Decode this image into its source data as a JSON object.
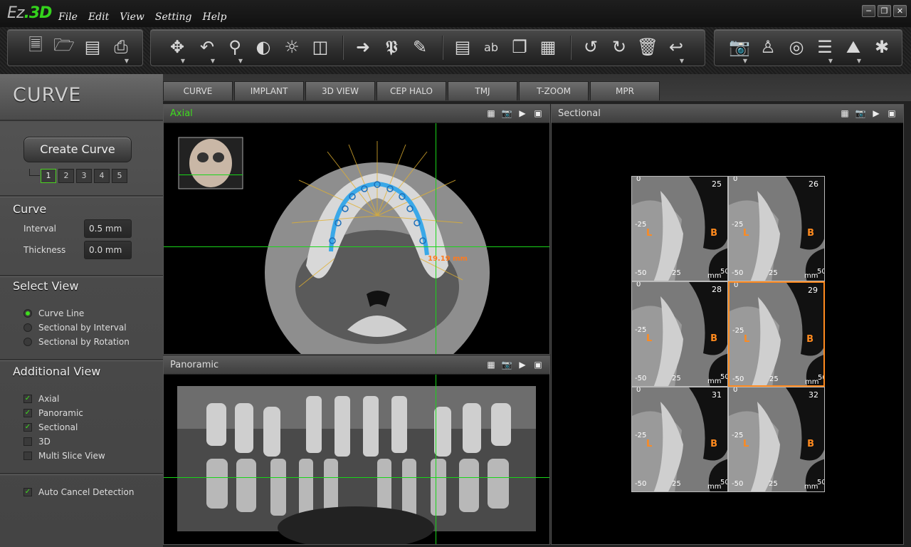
{
  "app": {
    "logo_prefix": "Ez",
    "logo_dot": ".",
    "logo_suffix": "3D"
  },
  "menu": [
    "File",
    "Edit",
    "View",
    "Setting",
    "Help"
  ],
  "window_controls": [
    "minimize",
    "restore",
    "close"
  ],
  "toolbar": {
    "group1": [
      "open-patient-icon",
      "import-icon",
      "save-icon",
      "print-icon"
    ],
    "group2": [
      "move-icon",
      "undo-rotate-icon",
      "zoom-icon",
      "contrast-icon",
      "brightness-icon",
      "columns-icon",
      "arrow-icon",
      "text-icon",
      "pencil-icon",
      "layers-icon",
      "abc-icon",
      "cube-icon",
      "checker-icon",
      "undo-icon",
      "redo-icon",
      "trash-icon",
      "redo-curve-icon"
    ],
    "group3": [
      "camera-icon",
      "person-icon",
      "disc-icon",
      "sliders-icon",
      "image-icon",
      "settings-icon"
    ]
  },
  "mode": {
    "title": "CURVE"
  },
  "left": {
    "create_curve": "Create Curve",
    "curve_numbers": [
      "1",
      "2",
      "3",
      "4",
      "5"
    ],
    "curve_section": {
      "title": "Curve",
      "interval_label": "Interval",
      "interval_value": "0.5 mm",
      "thickness_label": "Thickness",
      "thickness_value": "0.0 mm"
    },
    "select_view": {
      "title": "Select View",
      "options": [
        {
          "label": "Curve Line",
          "selected": true
        },
        {
          "label": "Sectional by Interval",
          "selected": false
        },
        {
          "label": "Sectional by Rotation",
          "selected": false
        }
      ]
    },
    "additional_view": {
      "title": "Additional View",
      "options": [
        {
          "label": "Axial",
          "checked": true
        },
        {
          "label": "Panoramic",
          "checked": true
        },
        {
          "label": "Sectional",
          "checked": true
        },
        {
          "label": "3D",
          "checked": false
        },
        {
          "label": "Multi Slice View",
          "checked": false
        }
      ]
    },
    "auto_cancel": {
      "label": "Auto Cancel Detection",
      "checked": true
    }
  },
  "tabs": [
    "CURVE",
    "IMPLANT",
    "3D VIEW",
    "CEP HALO",
    "TMJ",
    "T-ZOOM",
    "MPR"
  ],
  "views": {
    "axial": {
      "title": "Axial",
      "measurement": "19.19 mm"
    },
    "panoramic": {
      "title": "Panoramic"
    },
    "sectional": {
      "title": "Sectional"
    }
  },
  "sectional_slices": [
    {
      "num": "25",
      "selected": false
    },
    {
      "num": "26",
      "selected": false
    },
    {
      "num": "28",
      "selected": false
    },
    {
      "num": "29",
      "selected": true
    },
    {
      "num": "31",
      "selected": false
    },
    {
      "num": "32",
      "selected": false
    }
  ],
  "sectional_labels": {
    "left": "L",
    "right": "B",
    "top_tick": "0",
    "mid_tick": "-25",
    "bottom_tick": "-50",
    "x_mid": "25",
    "x_unit": "mm",
    "x_end": "50"
  },
  "colors": {
    "accent_green": "#3fdc1e",
    "crosshair": "#19d519",
    "curve": "#3aa8e8",
    "highlight": "#ff8a1e"
  }
}
